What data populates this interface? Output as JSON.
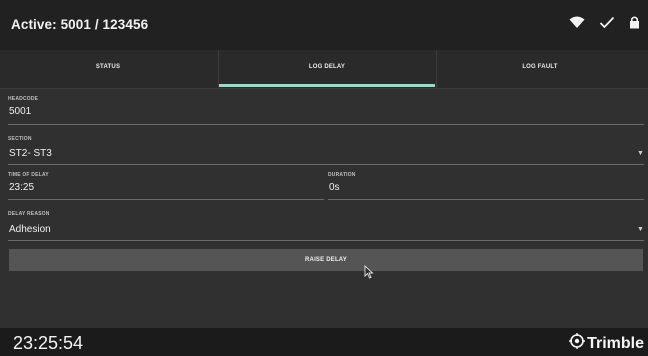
{
  "header": {
    "title": "Active: 5001 / 123456",
    "icons": [
      "wifi-icon",
      "check-icon",
      "lock-icon"
    ]
  },
  "tabs": [
    {
      "label": "STATUS",
      "active": false
    },
    {
      "label": "LOG DELAY",
      "active": true
    },
    {
      "label": "LOG FAULT",
      "active": false
    }
  ],
  "form": {
    "headcode": {
      "label": "HEADCODE",
      "value": "5001"
    },
    "section": {
      "label": "SECTION",
      "value": "ST2- ST3"
    },
    "time_of_delay": {
      "label": "TIME OF DELAY",
      "value": "23:25"
    },
    "duration": {
      "label": "DURATION",
      "value": "0s"
    },
    "delay_reason": {
      "label": "DELAY REASON",
      "value": "Adhesion"
    },
    "raise_button": "RAISE DELAY"
  },
  "footer": {
    "clock": "23:25:54",
    "brand": "Trimble"
  },
  "colors": {
    "accent": "#9fd8c6",
    "background": "#303030",
    "topbar": "#212121",
    "button": "#555555"
  }
}
